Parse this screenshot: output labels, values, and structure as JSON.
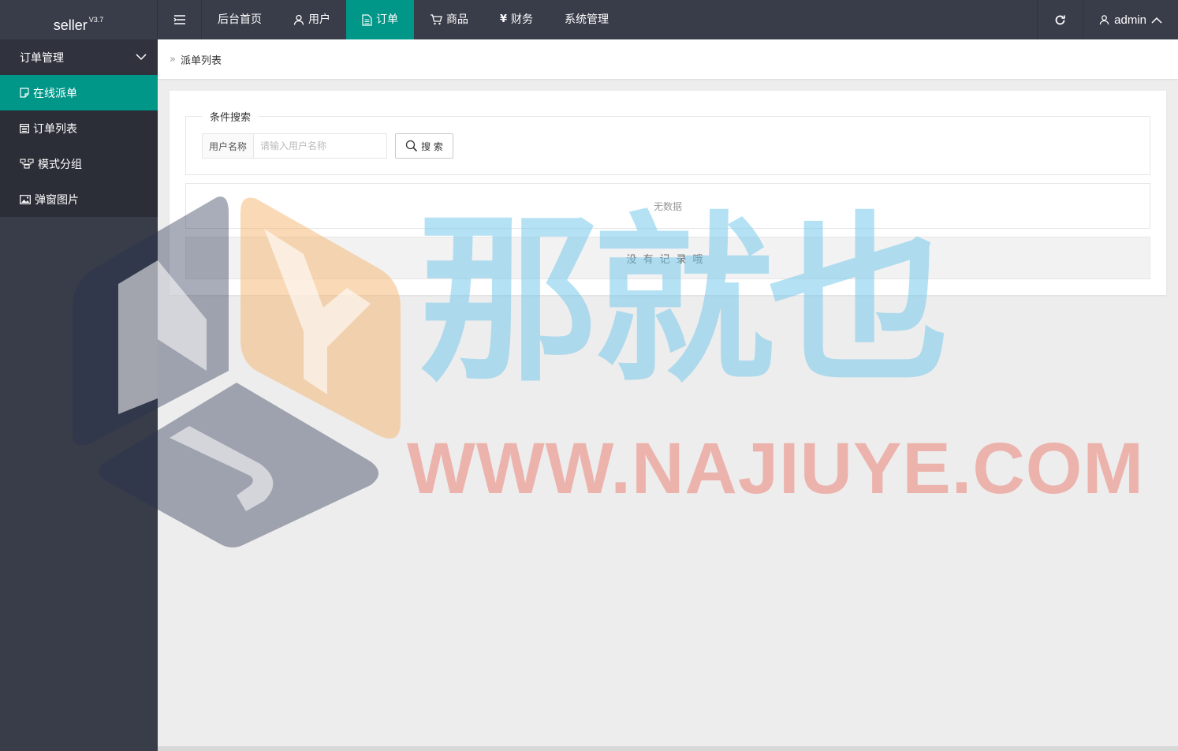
{
  "brand": {
    "name": "seller",
    "version": "V3.7"
  },
  "nav": {
    "items": [
      {
        "label": "后台首页",
        "icon": "none",
        "active": false
      },
      {
        "label": "用户",
        "icon": "user-icon",
        "active": false
      },
      {
        "label": "订单",
        "icon": "document-icon",
        "active": true
      },
      {
        "label": "商品",
        "icon": "cart-icon",
        "active": false
      },
      {
        "label": "财务",
        "icon": "yen-icon",
        "active": false
      },
      {
        "label": "系统管理",
        "icon": "none",
        "active": false
      }
    ],
    "yen_symbol": "¥"
  },
  "top_right": {
    "user": "admin"
  },
  "sidebar": {
    "header": "订单管理",
    "items": [
      {
        "label": "在线派单",
        "icon": "note-icon",
        "active": true
      },
      {
        "label": "订单列表",
        "icon": "calendar-icon",
        "active": false
      },
      {
        "label": "模式分组",
        "icon": "group-icon",
        "active": false
      },
      {
        "label": "弹窗图片",
        "icon": "image-icon",
        "active": false
      }
    ]
  },
  "breadcrumb": {
    "separator": "»",
    "current": "派单列表"
  },
  "search": {
    "legend": "条件搜索",
    "field_label": "用户名称",
    "placeholder": "请输入用户名称",
    "value": "",
    "button": "搜 索"
  },
  "table": {
    "empty_text": "无数据"
  },
  "footer_note": "没有记录哦",
  "watermark": {
    "cn": "那就也",
    "en": "WWW.NAJIUYE.COM"
  },
  "colors": {
    "topbar": "#393d49",
    "accent": "#009688",
    "sidebar_item": "#2b2e37"
  }
}
